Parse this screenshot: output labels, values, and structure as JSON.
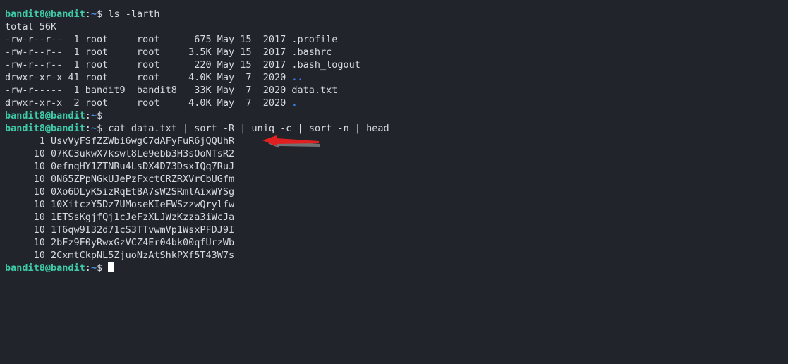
{
  "terminal": {
    "background_color": "#21252b",
    "prompt": {
      "user_host": "bandit8@bandit",
      "colon": ":",
      "path": "~",
      "dollar": "$ ",
      "user_host_color": "#3ec9a7",
      "path_color": "#4a90e2",
      "text_color": "#d7dae0"
    },
    "lines": [
      {
        "kind": "prompt",
        "command": "ls -larth"
      },
      {
        "kind": "output",
        "text": "total 56K"
      },
      {
        "kind": "listing",
        "prefix": "-rw-r--r--  1 root     root      675 May 15  2017 ",
        "name": ".profile",
        "name_type": "file"
      },
      {
        "kind": "listing",
        "prefix": "-rw-r--r--  1 root     root     3.5K May 15  2017 ",
        "name": ".bashrc",
        "name_type": "file"
      },
      {
        "kind": "listing",
        "prefix": "-rw-r--r--  1 root     root      220 May 15  2017 ",
        "name": ".bash_logout",
        "name_type": "file"
      },
      {
        "kind": "listing",
        "prefix": "drwxr-xr-x 41 root     root     4.0K May  7  2020 ",
        "name": "..",
        "name_type": "dir"
      },
      {
        "kind": "listing",
        "prefix": "-rw-r-----  1 bandit9  bandit8   33K May  7  2020 ",
        "name": "data.txt",
        "name_type": "file"
      },
      {
        "kind": "listing",
        "prefix": "drwxr-xr-x  2 root     root     4.0K May  7  2020 ",
        "name": ".",
        "name_type": "dir"
      },
      {
        "kind": "prompt",
        "command": ""
      },
      {
        "kind": "prompt",
        "command": "cat data.txt | sort -R | uniq -c | sort -n | head"
      },
      {
        "kind": "output",
        "text": "      1 UsvVyFSfZZWbi6wgC7dAFyFuR6jQQUhR"
      },
      {
        "kind": "output",
        "text": "     10 07KC3ukwX7kswl8Le9ebb3H3sOoNTsR2"
      },
      {
        "kind": "output",
        "text": "     10 0efnqHY1ZTNRu4LsDX4D73DsxIQq7RuJ"
      },
      {
        "kind": "output",
        "text": "     10 0N65ZPpNGkUJePzFxctCRZRXVrCbUGfm"
      },
      {
        "kind": "output",
        "text": "     10 0Xo6DLyK5izRqEtBA7sW2SRmlAixWYSg"
      },
      {
        "kind": "output",
        "text": "     10 10XitczY5Dz7UMoseKIeFWSzzwQrylfw"
      },
      {
        "kind": "output",
        "text": "     10 1ETSsKgjfQj1cJeFzXLJWzKzza3iWcJa"
      },
      {
        "kind": "output",
        "text": "     10 1T6qw9I32d71cS3TTvwmVp1WsxPFDJ9I"
      },
      {
        "kind": "output",
        "text": "     10 2bFz9F0yRwxGzVCZ4Er04bk00qfUrzWb"
      },
      {
        "kind": "output",
        "text": "     10 2CxmtCkpNL5ZjuoNzAtShkPXf5T43W7s"
      },
      {
        "kind": "prompt",
        "command": "",
        "cursor": true
      }
    ],
    "annotation": {
      "type": "arrow",
      "direction": "left",
      "color": "#e02020",
      "shadow_color": "#8a8a8a",
      "points_at_line_index": 10
    }
  }
}
